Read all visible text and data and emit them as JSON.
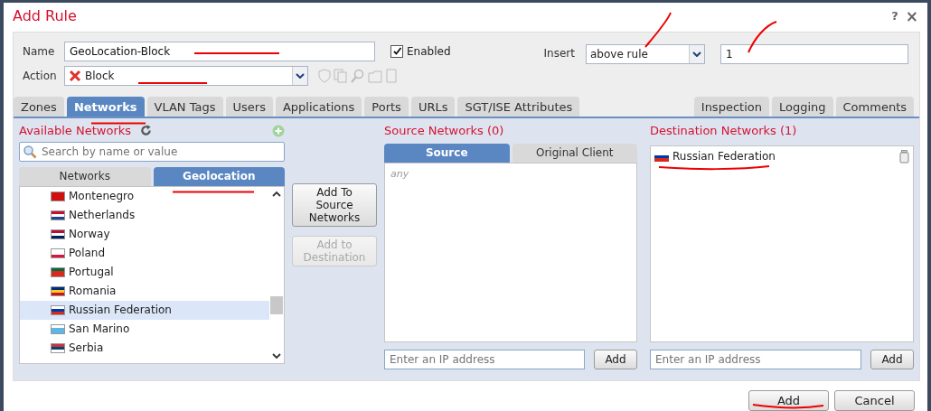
{
  "window": {
    "title": "Add Rule",
    "help": "?",
    "close": "×"
  },
  "name_field": {
    "label": "Name",
    "value": "GeoLocation-Block"
  },
  "enabled": {
    "label": "Enabled",
    "checked": true
  },
  "insert": {
    "label": "Insert",
    "value": "above rule",
    "rule_number": "1"
  },
  "action": {
    "label": "Action",
    "value": "Block"
  },
  "tabs": [
    {
      "label": "Zones",
      "selected": false
    },
    {
      "label": "Networks",
      "selected": true
    },
    {
      "label": "VLAN Tags",
      "selected": false
    },
    {
      "label": "Users",
      "selected": false
    },
    {
      "label": "Applications",
      "selected": false
    },
    {
      "label": "Ports",
      "selected": false
    },
    {
      "label": "URLs",
      "selected": false
    },
    {
      "label": "SGT/ISE Attributes",
      "selected": false
    }
  ],
  "tabs_right": [
    {
      "label": "Inspection",
      "selected": false
    },
    {
      "label": "Logging",
      "selected": false
    },
    {
      "label": "Comments",
      "selected": false
    }
  ],
  "available": {
    "title": "Available Networks",
    "search_placeholder": "Search by name or value",
    "subtabs": [
      {
        "label": "Networks",
        "selected": false
      },
      {
        "label": "Geolocation",
        "selected": true
      }
    ],
    "items": [
      {
        "label": "Montenegro",
        "selected": false
      },
      {
        "label": "Netherlands",
        "selected": false
      },
      {
        "label": "Norway",
        "selected": false
      },
      {
        "label": "Poland",
        "selected": false
      },
      {
        "label": "Portugal",
        "selected": false
      },
      {
        "label": "Romania",
        "selected": false
      },
      {
        "label": "Russian Federation",
        "selected": true
      },
      {
        "label": "San Marino",
        "selected": false
      },
      {
        "label": "Serbia",
        "selected": false
      }
    ]
  },
  "move_buttons": [
    {
      "label": "Add To Source Networks",
      "disabled": false
    },
    {
      "label": "Add to Destination",
      "disabled": true
    }
  ],
  "source": {
    "title": "Source Networks (0)",
    "subtabs": [
      {
        "label": "Source",
        "selected": true
      },
      {
        "label": "Original Client",
        "selected": false
      }
    ],
    "empty_text": "any",
    "ip_placeholder": "Enter an IP address",
    "add_label": "Add"
  },
  "destination": {
    "title": "Destination Networks (1)",
    "items": [
      {
        "label": "Russian Federation"
      }
    ],
    "ip_placeholder": "Enter an IP address",
    "add_label": "Add"
  },
  "footer_buttons": [
    {
      "label": "Add"
    },
    {
      "label": "Cancel"
    }
  ]
}
